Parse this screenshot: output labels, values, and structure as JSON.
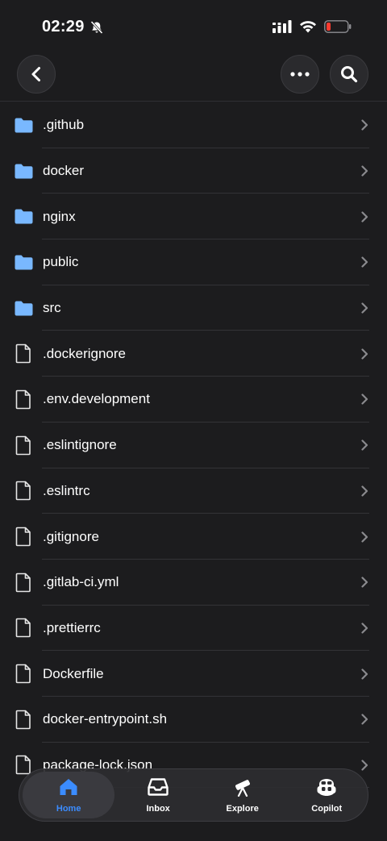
{
  "status_bar": {
    "time": "02:29",
    "icons": [
      "bell-slash-icon",
      "signal-icon",
      "wifi-icon",
      "battery-icon"
    ]
  },
  "nav": {
    "back_icon": "chevron-left-icon",
    "more_icon": "ellipsis-icon",
    "search_icon": "search-icon"
  },
  "files": [
    {
      "name": ".github",
      "type": "folder"
    },
    {
      "name": "docker",
      "type": "folder"
    },
    {
      "name": "nginx",
      "type": "folder"
    },
    {
      "name": "public",
      "type": "folder"
    },
    {
      "name": "src",
      "type": "folder"
    },
    {
      "name": ".dockerignore",
      "type": "file"
    },
    {
      "name": ".env.development",
      "type": "file"
    },
    {
      "name": ".eslintignore",
      "type": "file"
    },
    {
      "name": ".eslintrc",
      "type": "file"
    },
    {
      "name": ".gitignore",
      "type": "file"
    },
    {
      "name": ".gitlab-ci.yml",
      "type": "file"
    },
    {
      "name": ".prettierrc",
      "type": "file"
    },
    {
      "name": "Dockerfile",
      "type": "file"
    },
    {
      "name": "docker-entrypoint.sh",
      "type": "file"
    },
    {
      "name": "package-lock.json",
      "type": "file"
    }
  ],
  "tab_bar": {
    "tabs": [
      {
        "label": "Home",
        "icon": "home-icon",
        "active": true
      },
      {
        "label": "Inbox",
        "icon": "inbox-icon",
        "active": false
      },
      {
        "label": "Explore",
        "icon": "telescope-icon",
        "active": false
      },
      {
        "label": "Copilot",
        "icon": "copilot-icon",
        "active": false
      }
    ]
  },
  "colors": {
    "background": "#1c1c1e",
    "folder": "#79b8ff",
    "accent": "#3b8cff",
    "battery_low": "#ff3b30"
  }
}
